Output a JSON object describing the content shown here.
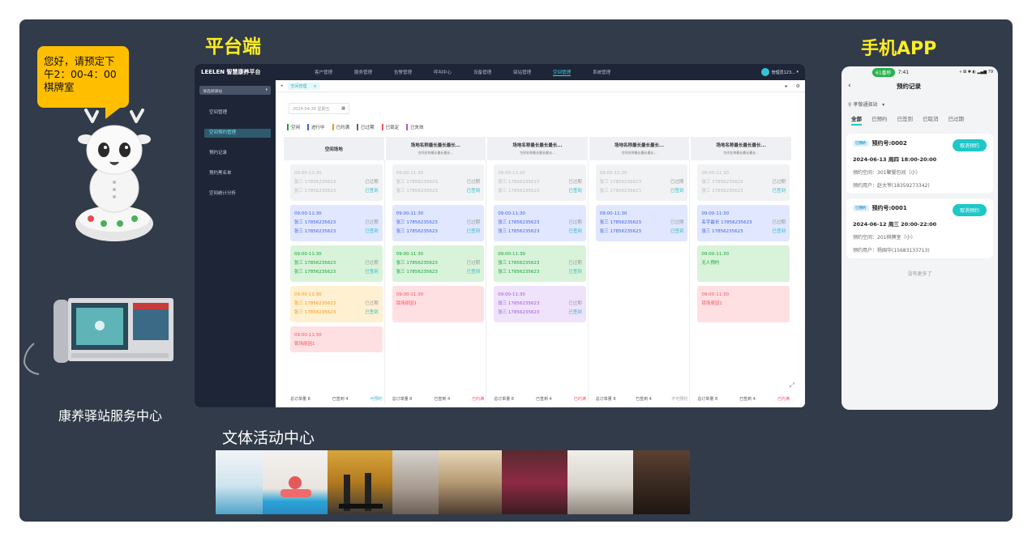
{
  "labels": {
    "platform": "平台端",
    "mobile_app": "手机APP",
    "service_center": "康养驿站服务中心",
    "activity_center": "文体活动中心"
  },
  "bubble": {
    "line1": "您好，请预定下",
    "line2": "午2：00-4：00",
    "line3": "棋牌室"
  },
  "platform": {
    "logo": "LEELEN 智慧康养平台",
    "nav": [
      "客户管理",
      "服务管理",
      "告警管理",
      "呼叫中心",
      "设备管理",
      "驿站管理",
      "空间管理",
      "系统管理"
    ],
    "nav_active_index": 6,
    "user": "管理员123...",
    "side_select": "请选择驿站",
    "side_items": [
      "空间管理",
      "空间预约管理",
      "预约记录",
      "预约黑名单",
      "空间统计分析"
    ],
    "side_active_index": 1,
    "tab": "空间管理",
    "date": "2024-04-26  星期五",
    "legend": [
      "空闲",
      "进行中",
      "已过期",
      "已过期",
      "已锁定",
      "已失效"
    ],
    "legend_colors": [
      "#19a23a",
      "#3f63e0",
      "#f29a0b",
      "#666666",
      "#ef5566",
      "#a15ad8"
    ],
    "first_col_header": "空间场地",
    "columns": [
      {
        "title": "场地名称最长最长最长...",
        "sub": "空间名称最长最长最长..."
      },
      {
        "title": "场地名称最长最长最长...",
        "sub": "空间名称最长最长最长..."
      },
      {
        "title": "场地名称最长最长最长...",
        "sub": "空间名称最长最长最长..."
      },
      {
        "title": "场地名称最长最长最长...",
        "sub": "空间名称最长最长最长..."
      }
    ],
    "time": "09:00-11:30",
    "phone_a": "张三 17856235623",
    "phone_b": "张三 17856235623",
    "long_name": "名字最长 17856235623",
    "nobody": "无人预约",
    "reason": "锁场原因1",
    "status_expired": "已过期",
    "status_signed": "已签到",
    "status_unsigned": "已签到",
    "footer": {
      "total": "总订单量 8",
      "signed": "已签到 4",
      "bookable": "可预约",
      "full": "已约满",
      "unavailable": "不可预约"
    }
  },
  "mobile": {
    "status_pill": "61番秒",
    "status_time": "7:41",
    "status_right": "⋄ ⊠ ✱ ◐ ▂▄▆ 79",
    "title": "预约记录",
    "station": "孝敬通驿站",
    "filters": [
      "全部",
      "已预约",
      "已签到",
      "已取消",
      "已过期"
    ],
    "badge": "已预约",
    "cancel": "取消预约",
    "cards": [
      {
        "no": "预约号:0002",
        "datetime": "2024-06-13 周四 18:00-20:00",
        "space": "预约空间：301聚餐包间（小）",
        "user": "预约用户：赵大爷(18359273342)"
      },
      {
        "no": "预约号:0001",
        "datetime": "2024-06-12 周三 20:00-22:00",
        "space": "预约空间：201棋牌室（小）",
        "user": "预约用户：杨国华(15683133713)"
      }
    ],
    "no_more": "没有更多了"
  },
  "colors": {
    "background": "#323b49",
    "accent": "#1ec7c8",
    "heading": "#ffee22",
    "bubble": "#ffbf00"
  }
}
